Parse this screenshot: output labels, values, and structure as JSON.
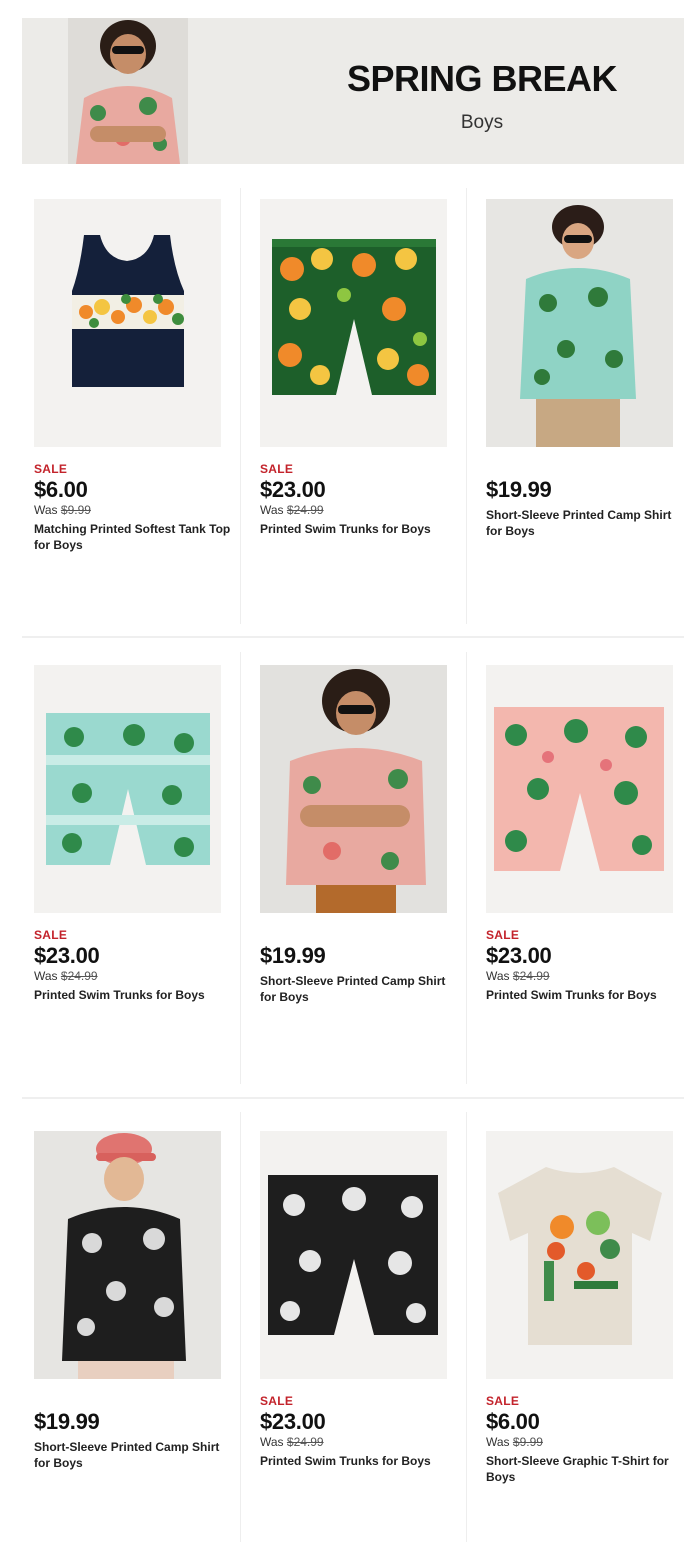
{
  "banner": {
    "title": "SPRING BREAK",
    "subtitle": "Boys",
    "image_icon": "boy-in-floral-shirt-photo"
  },
  "colors": {
    "sale": "#c3232b",
    "price": "#111111",
    "banner_bg": "#ecebe8"
  },
  "products": [
    {
      "sale_label": "SALE",
      "price": "$6.00",
      "was_prefix": "Was ",
      "was_price": "$9.99",
      "name": "Matching Printed Softest Tank Top for Boys",
      "image": "navy-tank-top-with-citrus-stripe"
    },
    {
      "sale_label": "SALE",
      "price": "$23.00",
      "was_prefix": "Was ",
      "was_price": "$24.99",
      "name": "Printed Swim Trunks for Boys",
      "image": "citrus-print-swim-trunks"
    },
    {
      "sale_label": "",
      "price": "$19.99",
      "was_prefix": "",
      "was_price": "",
      "name": "Short-Sleeve Printed Camp Shirt for Boys",
      "image": "boy-in-palm-print-camp-shirt"
    },
    {
      "sale_label": "SALE",
      "price": "$23.00",
      "was_prefix": "Was ",
      "was_price": "$24.99",
      "name": "Printed Swim Trunks for Boys",
      "image": "palm-print-swim-trunks"
    },
    {
      "sale_label": "",
      "price": "$19.99",
      "was_prefix": "",
      "was_price": "",
      "name": "Short-Sleeve Printed Camp Shirt for Boys",
      "image": "boy-in-floral-camp-shirt"
    },
    {
      "sale_label": "SALE",
      "price": "$23.00",
      "was_prefix": "Was ",
      "was_price": "$24.99",
      "name": "Printed Swim Trunks for Boys",
      "image": "pink-flamingo-swim-trunks"
    },
    {
      "sale_label": "",
      "price": "$19.99",
      "was_prefix": "",
      "was_price": "",
      "name": "Short-Sleeve Printed Camp Shirt for Boys",
      "image": "boy-in-black-leaf-camp-shirt"
    },
    {
      "sale_label": "SALE",
      "price": "$23.00",
      "was_prefix": "Was ",
      "was_price": "$24.99",
      "name": "Printed Swim Trunks for Boys",
      "image": "black-leaf-swim-trunks"
    },
    {
      "sale_label": "SALE",
      "price": "$6.00",
      "was_prefix": "Was ",
      "was_price": "$9.99",
      "name": "Short-Sleeve Graphic T-Shirt for Boys",
      "image": "graphic-t-shirt-tropical-flower"
    }
  ]
}
